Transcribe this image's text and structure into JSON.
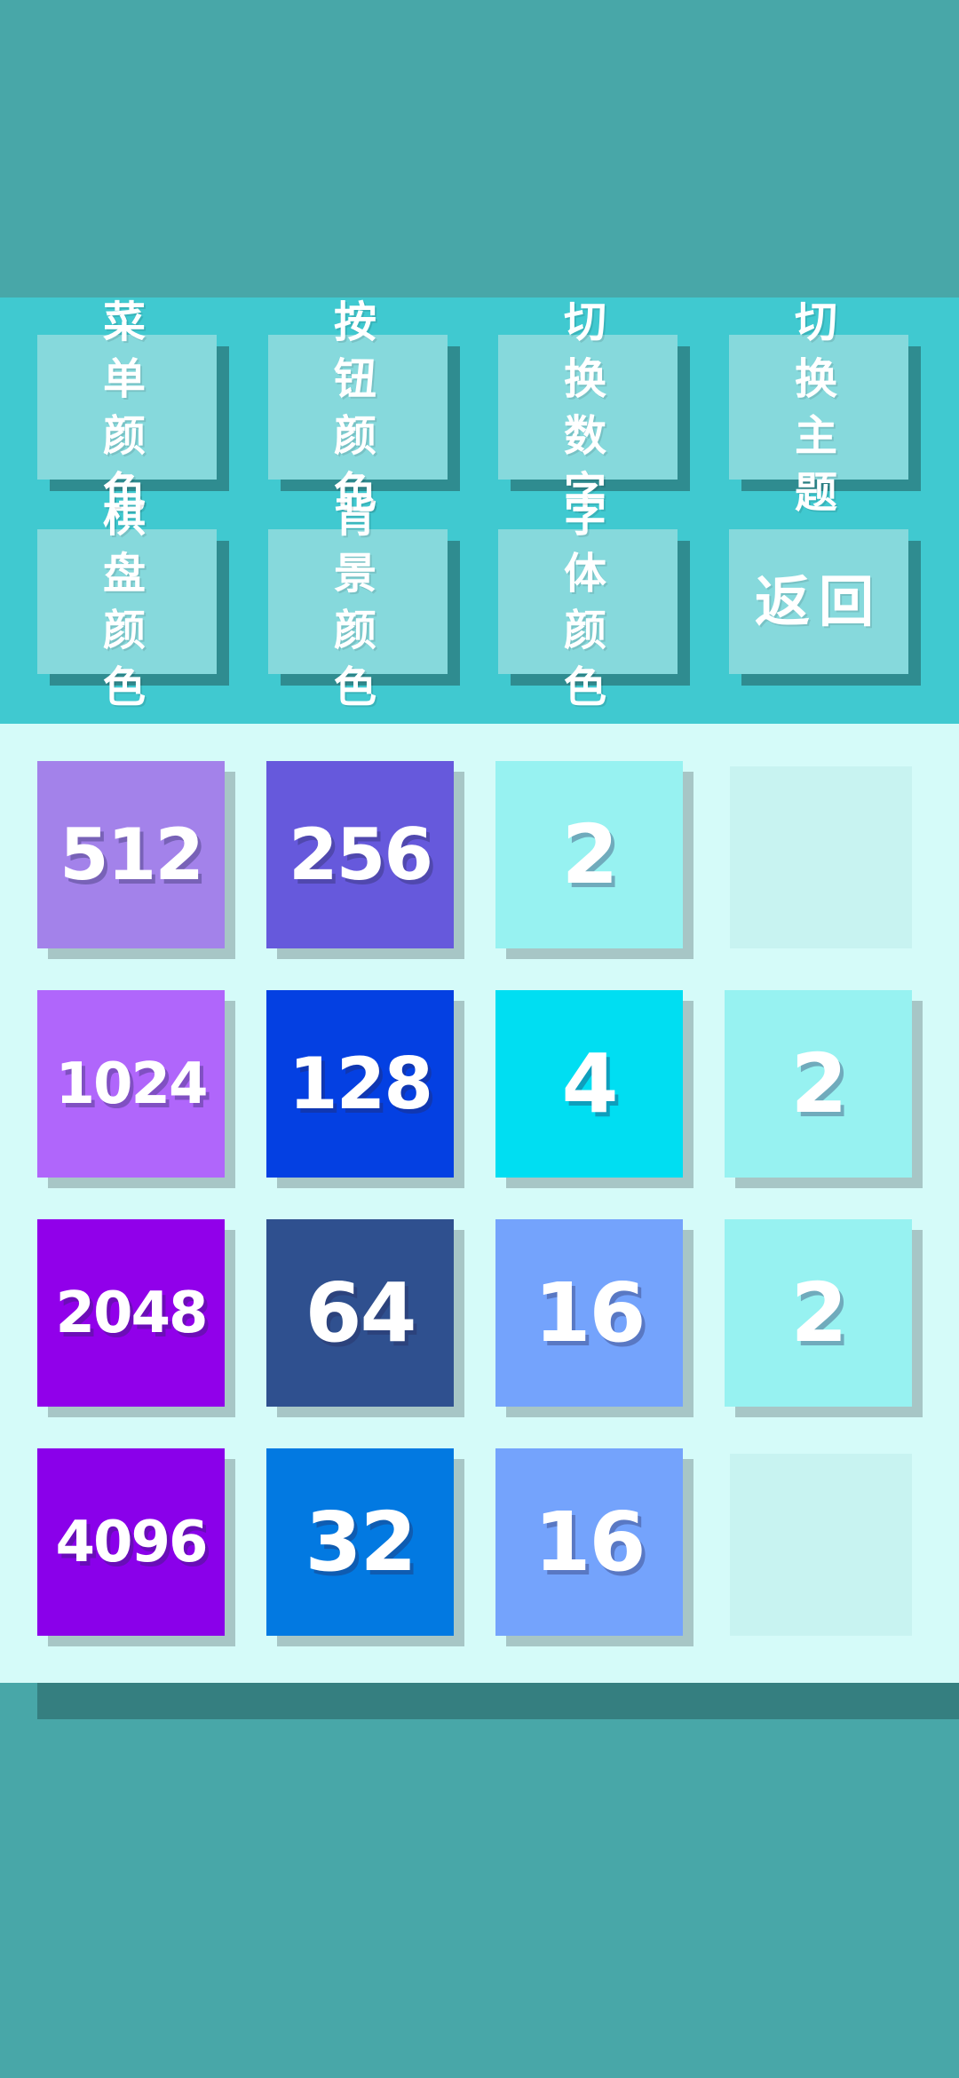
{
  "menu": {
    "buttons": [
      {
        "id": "menu-color",
        "label": "菜单颜色"
      },
      {
        "id": "button-color",
        "label": "按钮颜色"
      },
      {
        "id": "switch-numbers",
        "label": "切换数字"
      },
      {
        "id": "switch-theme",
        "label": "切换主题"
      },
      {
        "id": "board-color",
        "label": "棋盘颜色"
      },
      {
        "id": "background-color",
        "label": "背景颜色"
      },
      {
        "id": "font-color",
        "label": "字体颜色"
      },
      {
        "id": "back",
        "label": "返回"
      }
    ]
  },
  "board": {
    "rows": [
      [
        {
          "value": "512",
          "color": "#a382ea"
        },
        {
          "value": "256",
          "color": "#6659dc"
        },
        {
          "value": "2",
          "color": "#97f2f1"
        },
        {
          "value": "",
          "color": "#c8f3f1"
        }
      ],
      [
        {
          "value": "1024",
          "color": "#b066fb"
        },
        {
          "value": "128",
          "color": "#0440e2"
        },
        {
          "value": "4",
          "color": "#00def2"
        },
        {
          "value": "2",
          "color": "#97f2f1"
        }
      ],
      [
        {
          "value": "2048",
          "color": "#9100ea"
        },
        {
          "value": "64",
          "color": "#2f508f"
        },
        {
          "value": "16",
          "color": "#74a3fc"
        },
        {
          "value": "2",
          "color": "#97f2f1"
        }
      ],
      [
        {
          "value": "4096",
          "color": "#8a00ea"
        },
        {
          "value": "32",
          "color": "#0279e1"
        },
        {
          "value": "16",
          "color": "#74a3fc"
        },
        {
          "value": "",
          "color": "#c8f3f1"
        }
      ]
    ]
  },
  "colors": {
    "background": "#48a7a8",
    "menu_panel": "#40c9d0",
    "menu_button": "#86d9dc",
    "board": "#d5fbf9",
    "empty_cell": "#c8f3f1"
  }
}
